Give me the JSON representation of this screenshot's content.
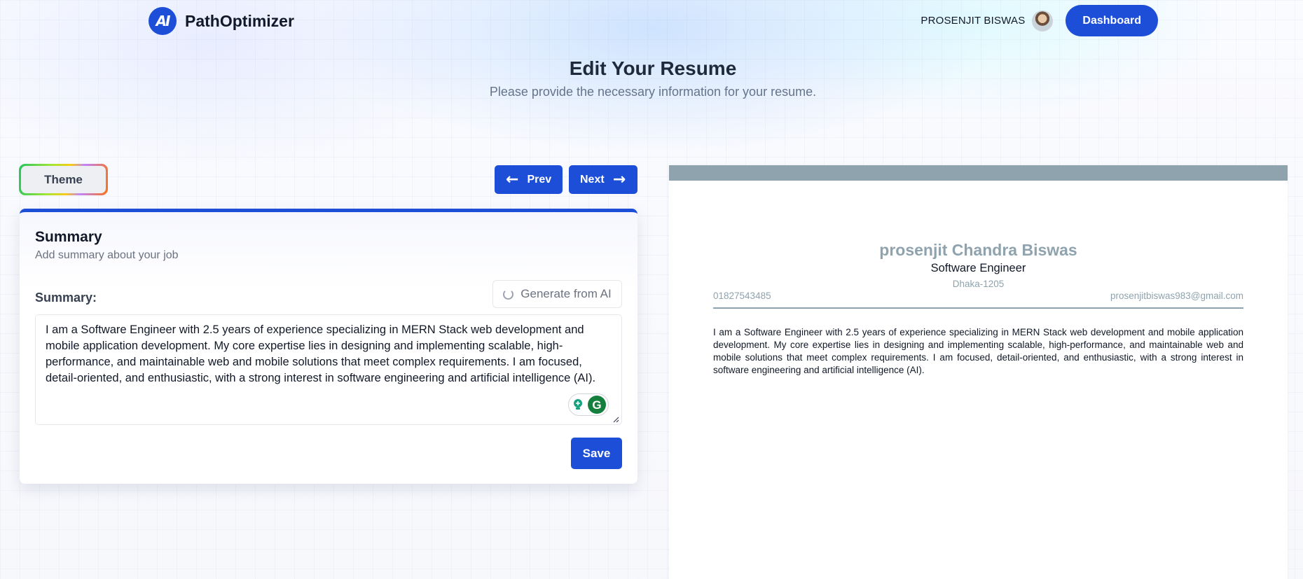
{
  "header": {
    "brand_name": "PathOptimizer",
    "user_name": "PROSENJIT BISWAS",
    "dashboard_label": "Dashboard"
  },
  "page": {
    "title": "Edit Your Resume",
    "subtitle": "Please provide the necessary information for your resume."
  },
  "toolbar": {
    "theme_label": "Theme",
    "prev_label": "Prev",
    "next_label": "Next"
  },
  "summary_card": {
    "title": "Summary",
    "subtitle": "Add summary about your job",
    "field_label": "Summary:",
    "ai_button_label": "Generate from AI",
    "text": " I am a Software Engineer with 2.5 years of experience specializing in MERN Stack web development and mobile application development. My core expertise lies in designing and implementing scalable, high-performance, and maintainable web and mobile solutions that meet complex requirements. I am focused, detail-oriented, and enthusiastic, with a strong interest in software engineering and artificial intelligence (AI).",
    "save_label": "Save"
  },
  "preview": {
    "name": "prosenjit Chandra Biswas",
    "job_title": "Software Engineer",
    "location": "Dhaka-1205",
    "phone": "01827543485",
    "email": "prosenjitbiswas983@gmail.com",
    "summary": "I am a Software Engineer with 2.5 years of experience specializing in MERN Stack web development and mobile application development. My core expertise lies in designing and implementing scalable, high-performance, and maintainable web and mobile solutions that meet complex requirements. I am focused, detail-oriented, and enthusiastic, with a strong interest in software engineering and artificial intelligence (AI).",
    "accent_color": "#8fa3ae"
  },
  "colors": {
    "primary": "#1d4ed8"
  }
}
